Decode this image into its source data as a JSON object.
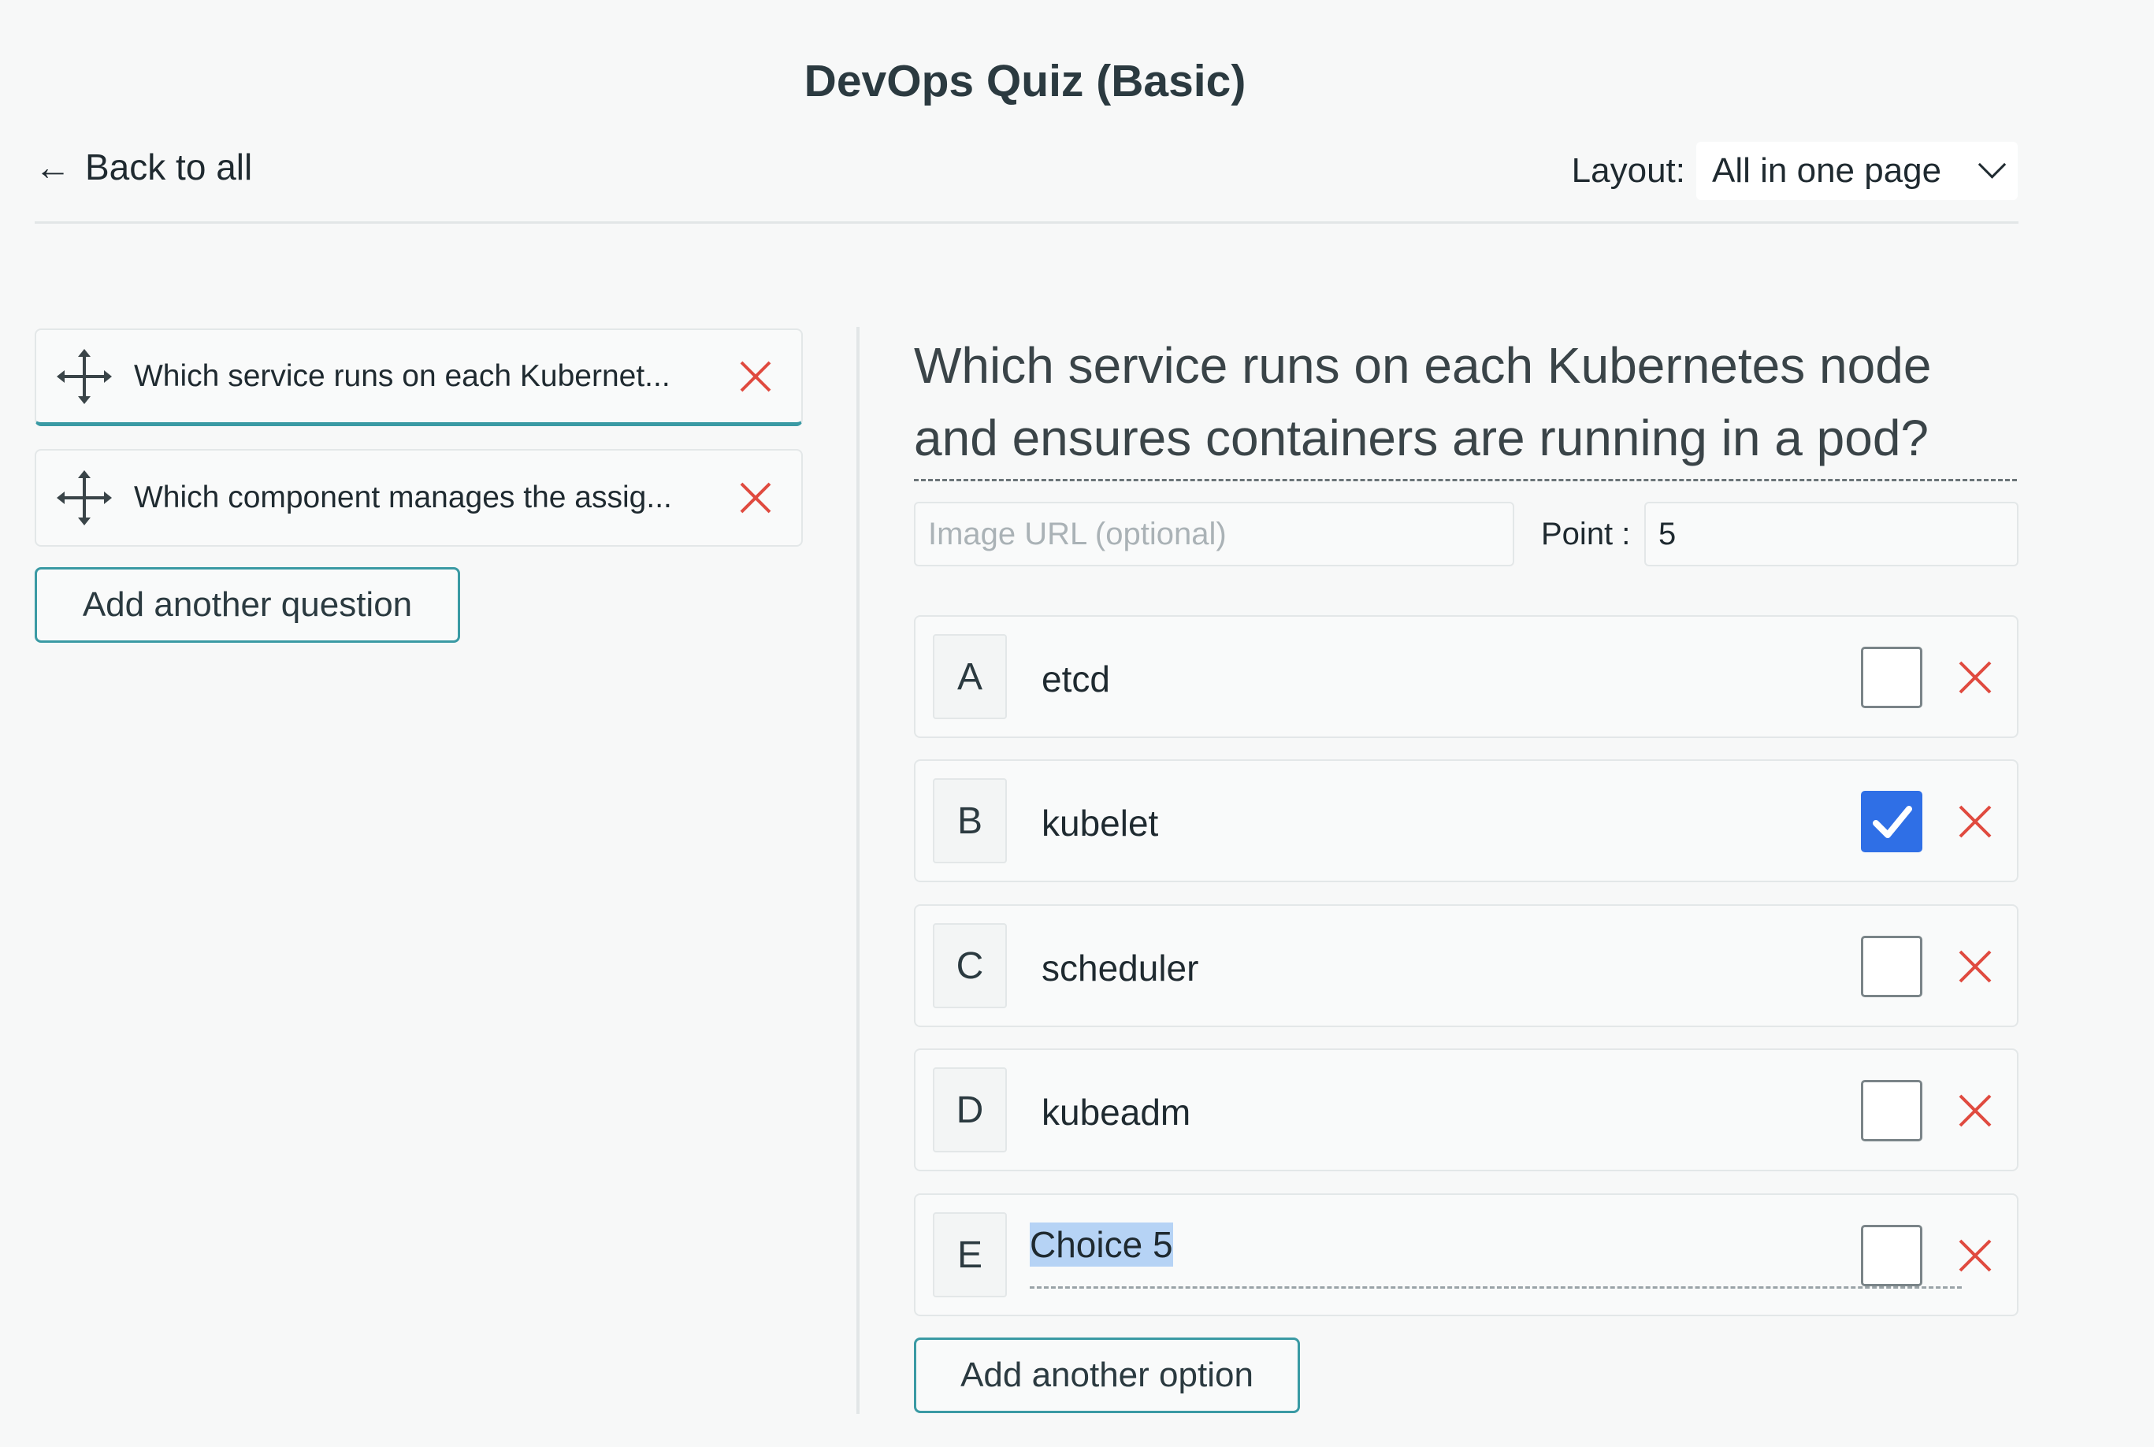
{
  "title": "DevOps Quiz (Basic)",
  "nav": {
    "back_label": "Back to all",
    "back_icon": "arrow-left-icon"
  },
  "layout": {
    "label": "Layout:",
    "value": "All in one page"
  },
  "questions": [
    {
      "label": "Which service runs on each Kubernet...",
      "active": true
    },
    {
      "label": "Which component manages the assig...",
      "active": false
    }
  ],
  "add_question_label": "Add another question",
  "editor": {
    "question": "Which service runs on each Kubernetes node and ensures containers are running in a pod?",
    "image_placeholder": "Image URL (optional)",
    "point_label": "Point :",
    "point_value": "5",
    "options": [
      {
        "letter": "A",
        "text": "etcd",
        "correct": false
      },
      {
        "letter": "B",
        "text": "kubelet",
        "correct": true
      },
      {
        "letter": "C",
        "text": "scheduler",
        "correct": false
      },
      {
        "letter": "D",
        "text": "kubeadm",
        "correct": false
      },
      {
        "letter": "E",
        "text": "Choice 5",
        "correct": false,
        "selected_text": true
      }
    ],
    "add_option_label": "Add another option"
  },
  "colors": {
    "accent": "#3a9aa4",
    "delete": "#e04a3f",
    "check": "#2f6fe6"
  }
}
